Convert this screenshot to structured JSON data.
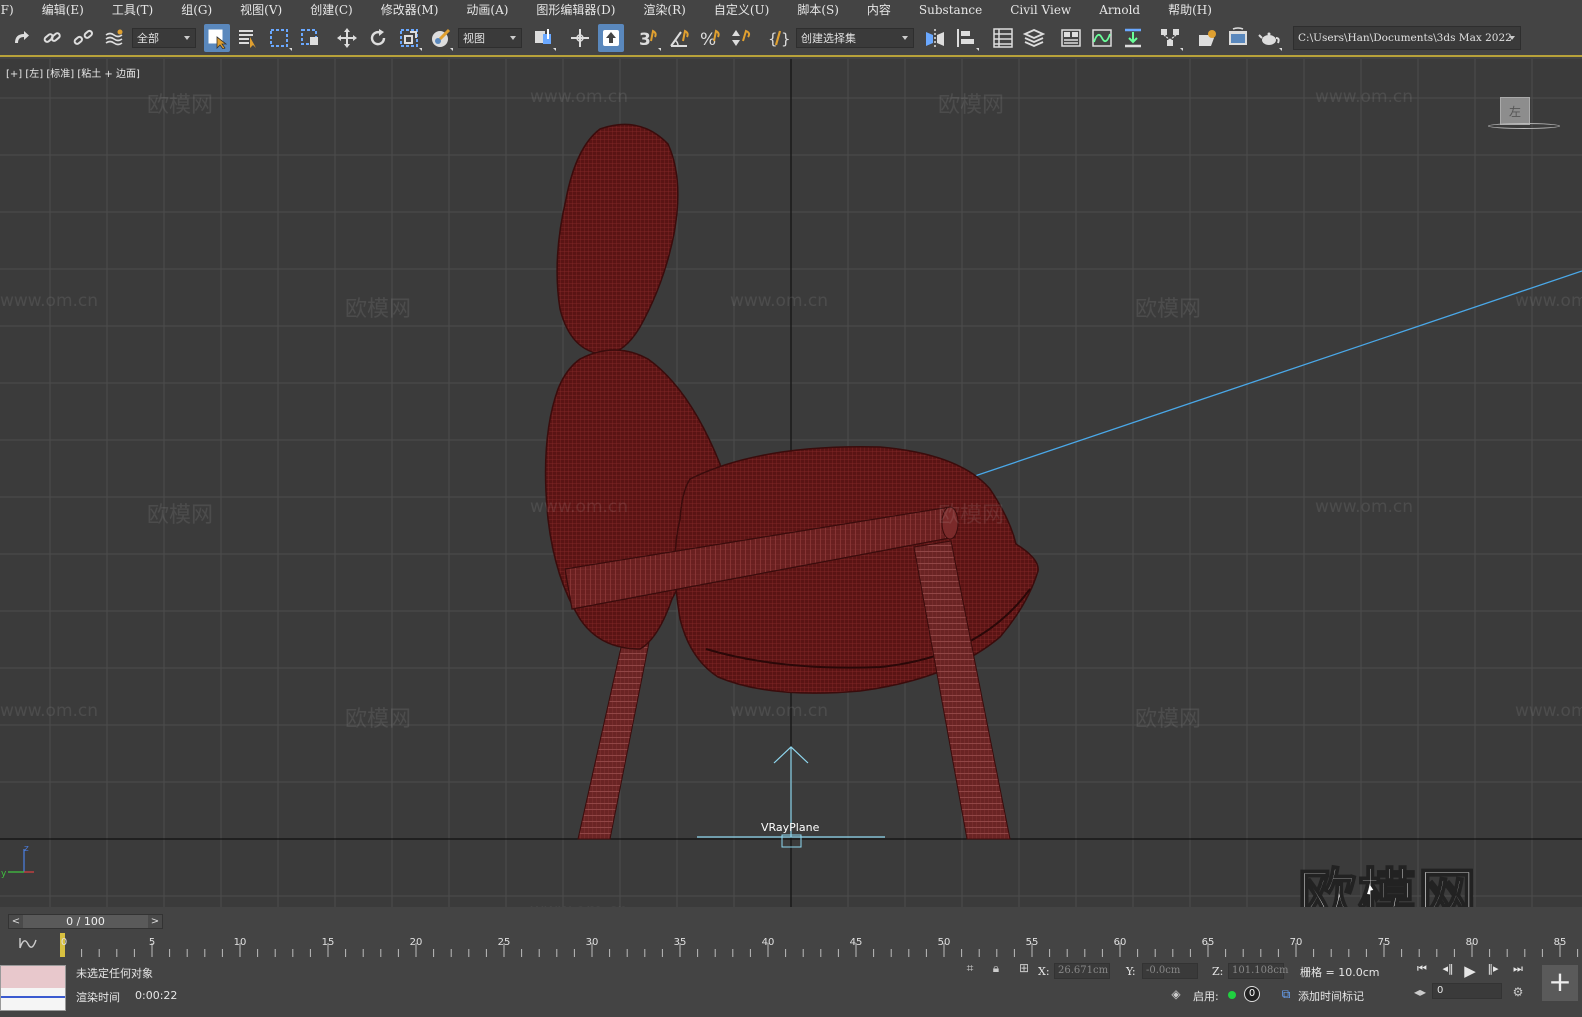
{
  "menu": [
    "(F)",
    "编辑(E)",
    "工具(T)",
    "组(G)",
    "视图(V)",
    "创建(C)",
    "修改器(M)",
    "动画(A)",
    "图形编辑器(D)",
    "渲染(R)",
    "自定义(U)",
    "脚本(S)",
    "内容",
    "Substance",
    "Civil View",
    "Arnold",
    "帮助(H)"
  ],
  "toolbar": {
    "selection_filter": "全部",
    "ref_coord": "视图",
    "named_selection": "创建选择集",
    "project_path": "C:\\Users\\Han\\Documents\\3ds Max 2022"
  },
  "viewport": {
    "label": "[+] [左] [标准] [粘土 + 边面]",
    "viewcube_face": "左",
    "gizmo_label": "VRayPlane",
    "watermark_brand": "欧模网",
    "watermark_url": "www.om.cn",
    "logo": "欧模网",
    "axis_labels": {
      "z": "z",
      "y": "y"
    }
  },
  "timeline": {
    "slider": "0 / 100",
    "prev": "<",
    "next": ">",
    "ticks": [
      "0",
      "5",
      "10",
      "15",
      "20",
      "25",
      "30",
      "35",
      "40",
      "45",
      "50",
      "55",
      "60",
      "65",
      "70",
      "75",
      "80",
      "85"
    ]
  },
  "status": {
    "message": "未选定任何对象",
    "render_time_label": "渲染时间",
    "render_time": "0:00:22",
    "x_label": "X:",
    "x": "26.671cm",
    "y_label": "Y:",
    "y": "-0.0cm",
    "z_label": "Z:",
    "z": "101.108cm",
    "grid": "栅格 = 10.0cm",
    "enable_label": "启用:",
    "badge": "0",
    "add_time_tag": "添加时间标记",
    "frame": "0"
  },
  "colors": {
    "accent": "#5a88bd",
    "timeline_border": "#b8a23a",
    "mesh": "#6a1a1a",
    "wire": "#a33a3a",
    "light_line": "#4aa8e8",
    "gizmo": "#8fd8f0"
  }
}
